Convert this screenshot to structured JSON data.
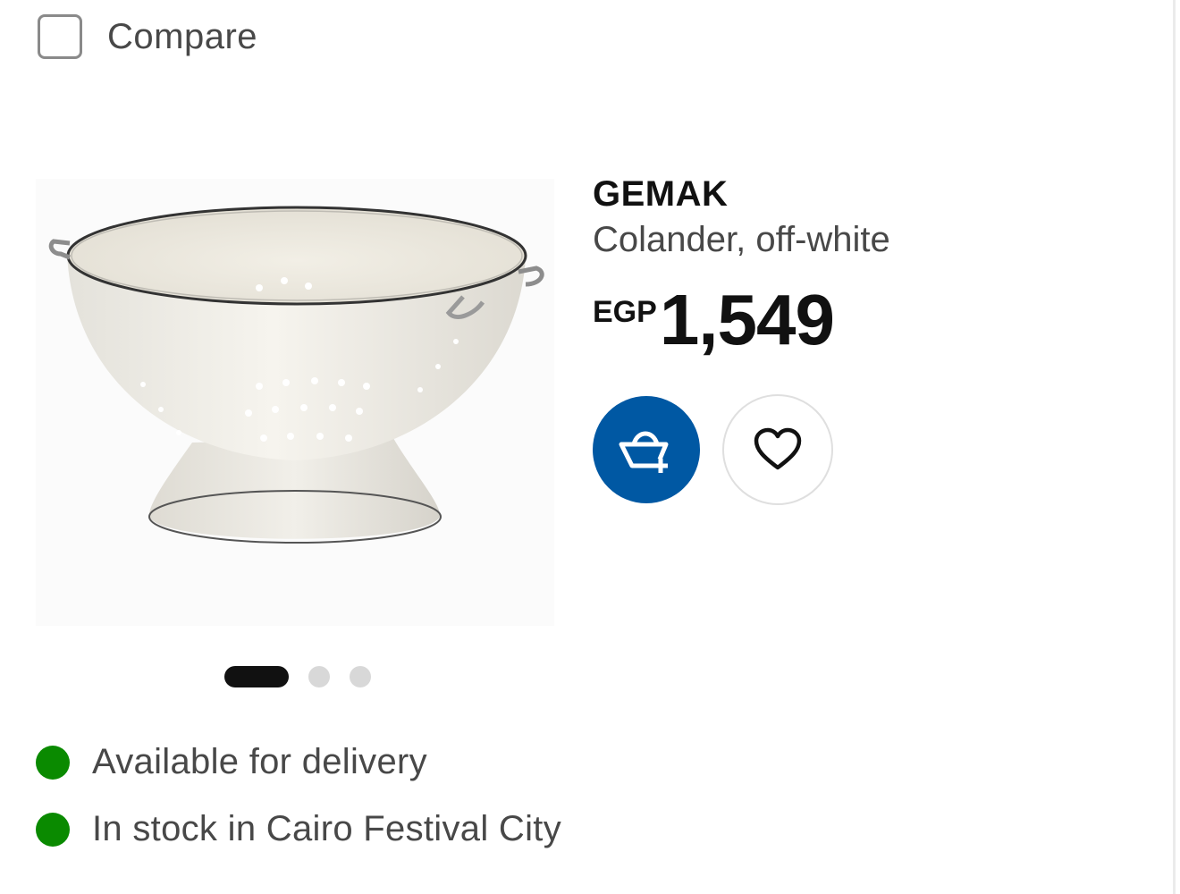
{
  "compare": {
    "label": "Compare",
    "checked": false
  },
  "product": {
    "brand": "GEMAK",
    "description": "Colander, off-white",
    "currency": "EGP",
    "price": "1,549",
    "image_alt": "colander-image"
  },
  "carousel": {
    "total": 3,
    "active_index": 0
  },
  "actions": {
    "add_to_cart_icon": "cart-plus-icon",
    "favourite_icon": "heart-icon"
  },
  "availability": [
    {
      "text": "Available for delivery",
      "status": "available"
    },
    {
      "text": "In stock in Cairo Festival City",
      "status": "in-stock"
    }
  ],
  "colors": {
    "accent": "#0058a3",
    "status_green": "#0a8a00",
    "text": "#111111",
    "muted_text": "#484848"
  }
}
